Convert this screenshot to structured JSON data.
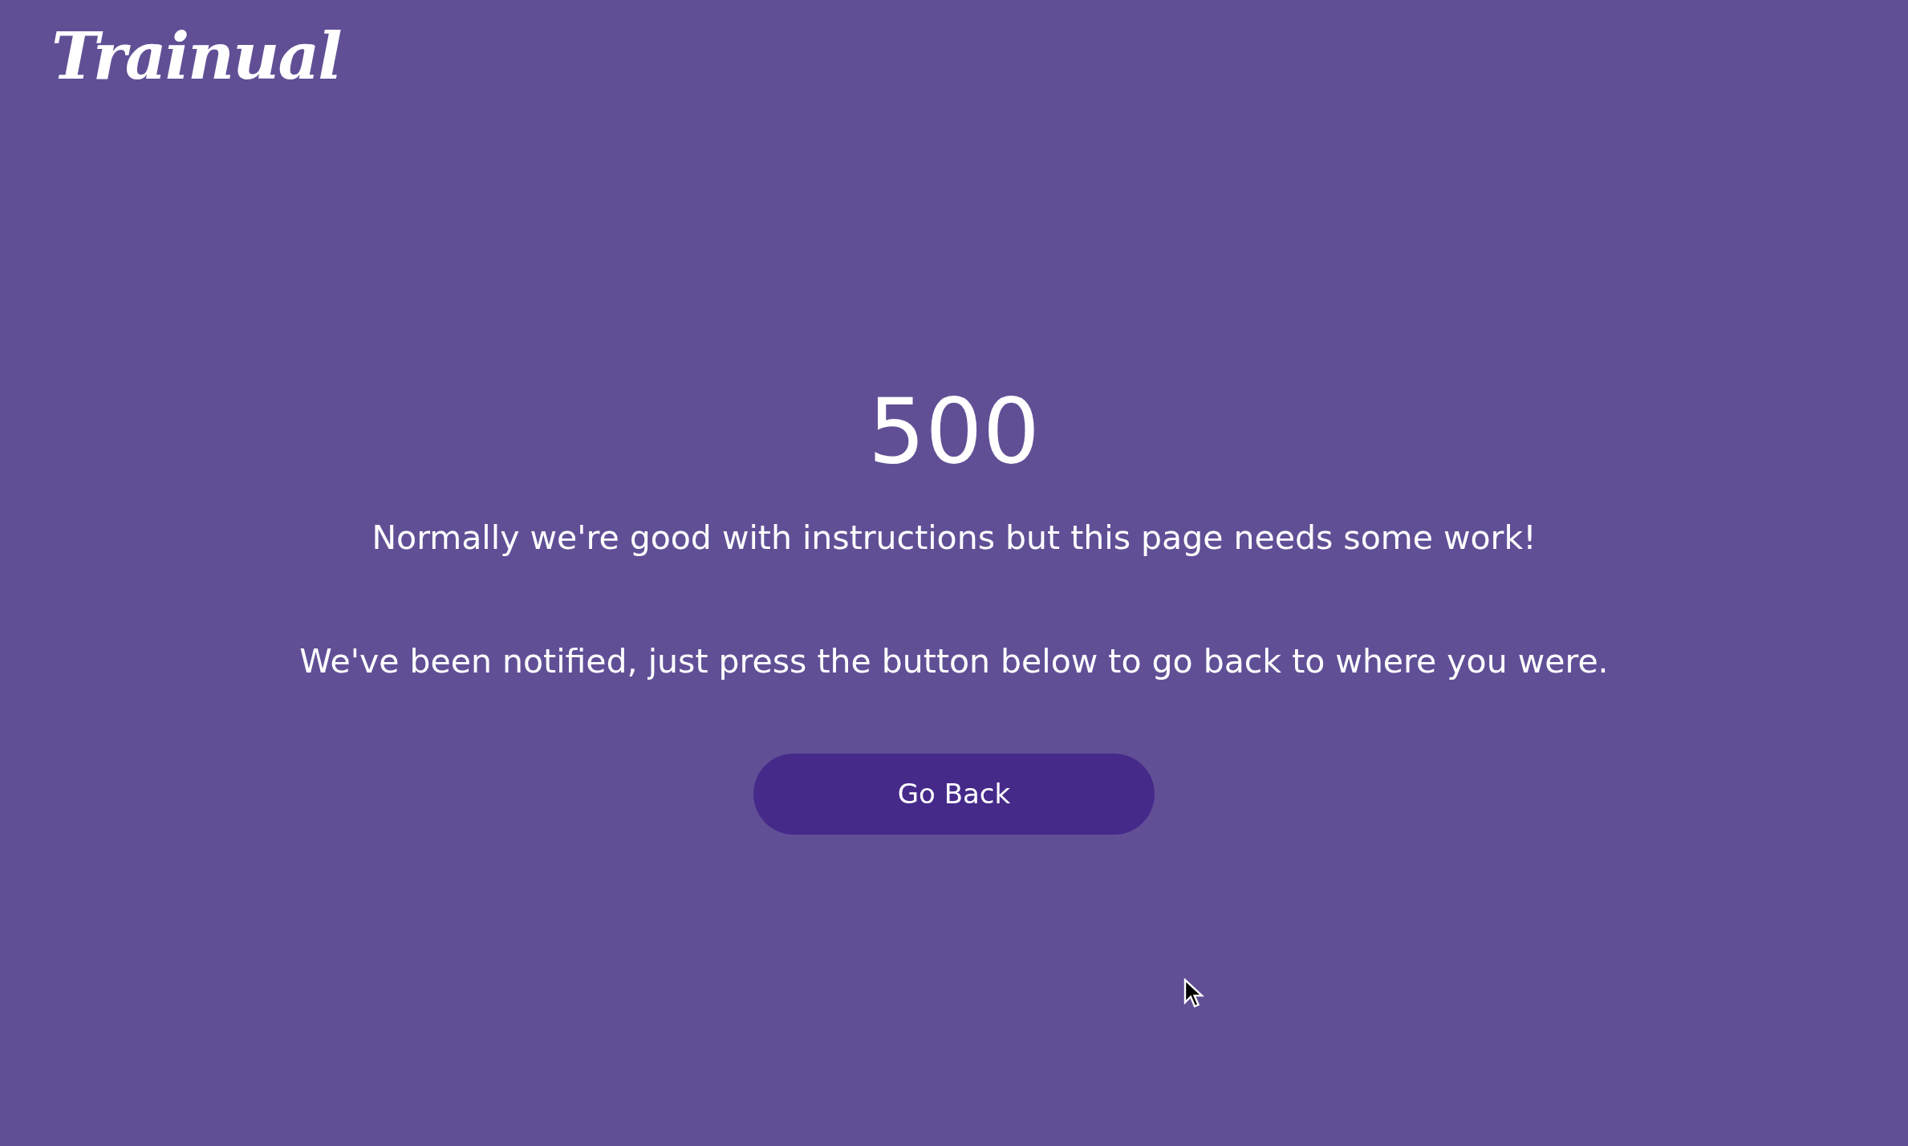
{
  "logo": {
    "text": "Trainual"
  },
  "error": {
    "code": "500",
    "messages": [
      "Normally we're good with instructions but this page needs some work!",
      "We've been notified, just press the button below to go back to where you were."
    ]
  },
  "button": {
    "label": "Go Back"
  }
}
